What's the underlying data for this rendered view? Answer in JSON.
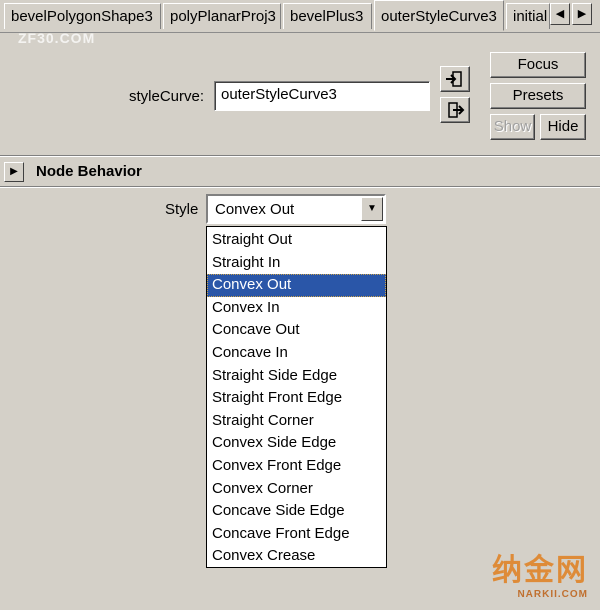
{
  "tabs": [
    {
      "label": "bevelPolygonShape3",
      "active": false
    },
    {
      "label": "polyPlanarProj3",
      "active": false
    },
    {
      "label": "bevelPlus3",
      "active": false
    },
    {
      "label": "outerStyleCurve3",
      "active": true
    },
    {
      "label": "initial",
      "active": false
    }
  ],
  "watermark_top": "ZF30.COM",
  "fields": {
    "style_curve_label": "styleCurve:",
    "style_curve_value": "outerStyleCurve3"
  },
  "buttons": {
    "focus": "Focus",
    "presets": "Presets",
    "show": "Show",
    "hide": "Hide"
  },
  "section": {
    "title": "Node Behavior",
    "style_label": "Style",
    "style_value": "Convex Out"
  },
  "dropdown_options": [
    "Straight Out",
    "Straight In",
    "Convex Out",
    "Convex In",
    "Concave Out",
    "Concave In",
    "Straight Side Edge",
    "Straight Front Edge",
    "Straight Corner",
    "Convex Side Edge",
    "Convex Front Edge",
    "Convex Corner",
    "Concave Side Edge",
    "Concave Front Edge",
    "Convex Crease"
  ],
  "selected_option": "Convex Out",
  "watermark": {
    "main": "纳金网",
    "sub": "NARKII.COM"
  },
  "colors": {
    "selection": "#2a56a8",
    "panel": "#d4d0c8",
    "watermark": "#e08020"
  }
}
